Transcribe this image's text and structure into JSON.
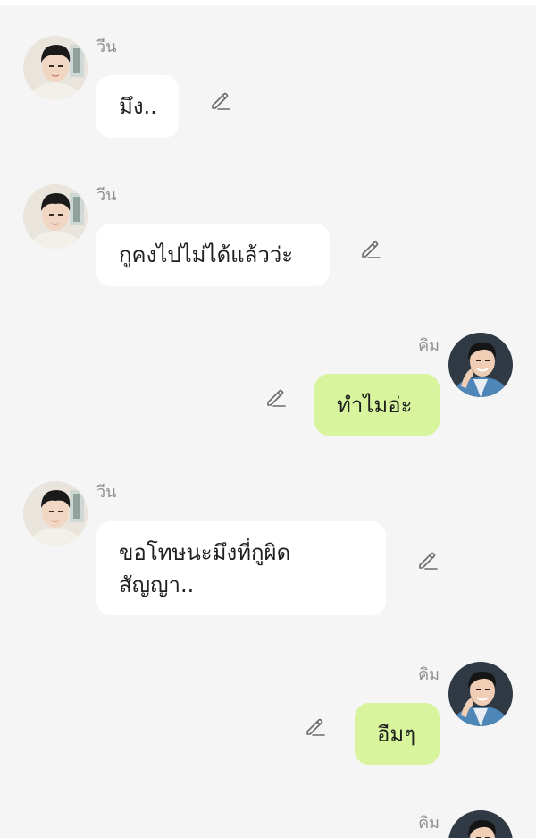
{
  "messages": [
    {
      "sender": "วีน",
      "direction": "incoming",
      "text": "มึง.."
    },
    {
      "sender": "วีน",
      "direction": "incoming",
      "text": "กูคงไปไม่ได้แล้วว่ะ"
    },
    {
      "sender": "คิม",
      "direction": "outgoing",
      "text": "ทำไมอ่ะ"
    },
    {
      "sender": "วีน",
      "direction": "incoming",
      "text": "ขอโทษนะมึงที่กูผิด\nสัญญา.."
    },
    {
      "sender": "คิม",
      "direction": "outgoing",
      "text": "อืมๆ"
    },
    {
      "sender": "คิม",
      "direction": "outgoing",
      "text": ""
    }
  ],
  "icons": {
    "edit": "pencil-edit-icon",
    "avatar_veen": "avatar-veen",
    "avatar_kim": "avatar-kim"
  },
  "colors": {
    "background": "#f5f5f5",
    "incoming_bubble": "#ffffff",
    "outgoing_bubble": "#d8f59e",
    "name_text": "#8e8e8e",
    "message_text": "#1f1f1f",
    "edit_icon": "#6b6b6b"
  }
}
